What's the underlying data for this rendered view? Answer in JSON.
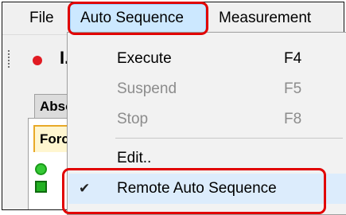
{
  "menubar": {
    "items": [
      "File",
      "Auto Sequence",
      "Measurement"
    ]
  },
  "toolbar": {
    "text": "I."
  },
  "tabs": {
    "outer_tab": "Abso",
    "inner_tab": "Forc"
  },
  "dropdown": {
    "items": [
      {
        "label": "Execute",
        "shortcut": "F4",
        "enabled": true
      },
      {
        "label": "Suspend",
        "shortcut": "F5",
        "enabled": false
      },
      {
        "label": "Stop",
        "shortcut": "F8",
        "enabled": false
      },
      {
        "label": "Edit..",
        "shortcut": "",
        "enabled": true
      },
      {
        "label": "Remote Auto Sequence",
        "shortcut": "",
        "enabled": true,
        "checked": true,
        "check_glyph": "✔"
      }
    ]
  },
  "colors": {
    "highlight_outline": "#e10000",
    "menu_selected_bg": "#cce8ff"
  }
}
